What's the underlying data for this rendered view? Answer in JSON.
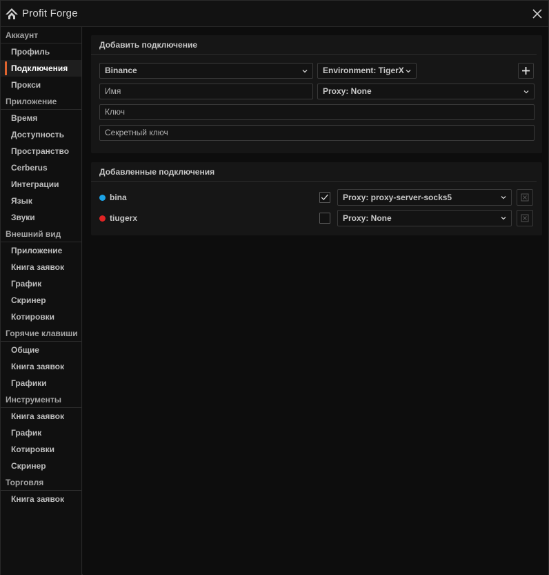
{
  "app": {
    "title": "Profit Forge"
  },
  "sidebar": {
    "sections": [
      {
        "label": "Аккаунт",
        "items": [
          "Профиль",
          "Подключения",
          "Прокси"
        ]
      },
      {
        "label": "Приложение",
        "items": [
          "Время",
          "Доступность",
          "Пространство",
          "Cerberus",
          "Интеграции",
          "Язык",
          "Звуки"
        ]
      },
      {
        "label": "Внешний вид",
        "items": [
          "Приложение",
          "Книга заявок",
          "График",
          "Скринер",
          "Котировки"
        ]
      },
      {
        "label": "Горячие клавиши",
        "items": [
          "Общие",
          "Книга заявок",
          "Графики"
        ]
      },
      {
        "label": "Инструменты",
        "items": [
          "Книга заявок",
          "График",
          "Котировки",
          "Скринер"
        ]
      },
      {
        "label": "Торговля",
        "items": [
          "Книга заявок"
        ]
      }
    ],
    "active": "Подключения"
  },
  "add_panel": {
    "title": "Добавить подключение",
    "exchange_select": "Binance",
    "environment_select": "Environment: TigerX",
    "name_placeholder": "Имя",
    "proxy_select": "Proxy: None",
    "key_placeholder": "Ключ",
    "secret_placeholder": "Секретный ключ"
  },
  "added_panel": {
    "title": "Добавленные подключения",
    "connections": [
      {
        "name": "bina",
        "color": "#1ca3e6",
        "checked": true,
        "proxy": "Proxy: proxy-server-socks5"
      },
      {
        "name": "tiugerx",
        "color": "#e02424",
        "checked": false,
        "proxy": "Proxy: None"
      }
    ]
  },
  "colors": {
    "accent": "#e0632e"
  }
}
